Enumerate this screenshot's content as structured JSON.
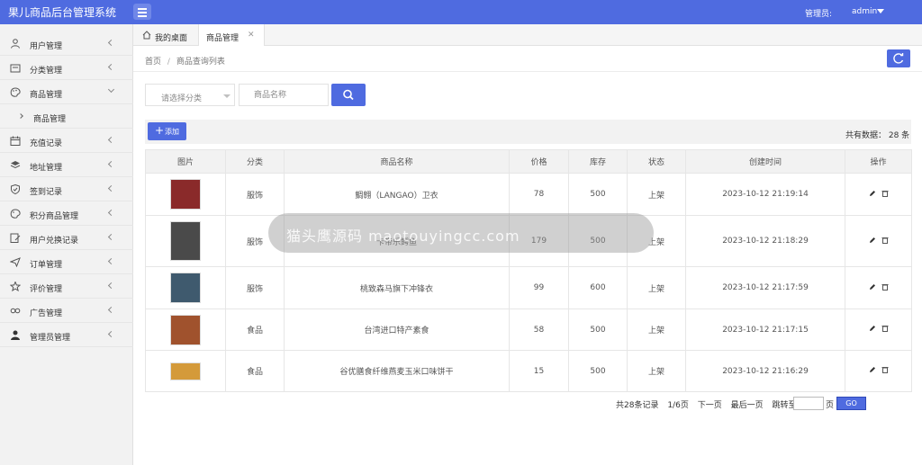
{
  "app": {
    "title": "果儿商品后台管理系统",
    "admin_label": "管理员:",
    "admin_name": "admin"
  },
  "sidebar": {
    "items": [
      {
        "label": "用户管理",
        "icon": "user-icon"
      },
      {
        "label": "分类管理",
        "icon": "category-icon"
      },
      {
        "label": "商品管理",
        "icon": "palette-icon",
        "expanded": true
      },
      {
        "label": "商品管理",
        "sub": true
      },
      {
        "label": "充值记录",
        "icon": "calendar-icon"
      },
      {
        "label": "地址管理",
        "icon": "layers-icon"
      },
      {
        "label": "签到记录",
        "icon": "shield-icon"
      },
      {
        "label": "积分商品管理",
        "icon": "palette-icon"
      },
      {
        "label": "用户兑换记录",
        "icon": "edit-doc-icon"
      },
      {
        "label": "订单管理",
        "icon": "send-icon"
      },
      {
        "label": "评价管理",
        "icon": "star-icon"
      },
      {
        "label": "广告管理",
        "icon": "link-icon"
      },
      {
        "label": "管理员管理",
        "icon": "admin-icon"
      }
    ]
  },
  "tabs": [
    {
      "label": "我的桌面"
    },
    {
      "label": "商品管理",
      "closable": true
    }
  ],
  "breadcrumb": {
    "home": "首页",
    "separator": "/",
    "current": "商品查询列表"
  },
  "search": {
    "category_placeholder": "请选择分类",
    "name_placeholder": "商品名称"
  },
  "toolbar": {
    "add_label": "添加",
    "total_text": "共有数据： 28 条"
  },
  "table": {
    "headers": [
      "图片",
      "分类",
      "商品名称",
      "价格",
      "库存",
      "状态",
      "创建时间",
      "操作"
    ],
    "rows": [
      {
        "category": "服饰",
        "name": "鲷翱（LANGAO）卫衣",
        "price": "78",
        "stock": "500",
        "status": "上架",
        "created": "2023-10-12 21:19:14",
        "thumb_color": "#8a2a2a"
      },
      {
        "category": "服饰",
        "name": "卡帝乐鳄鱼",
        "price": "179",
        "stock": "500",
        "status": "上架",
        "created": "2023-10-12 21:18:29",
        "thumb_color": "#4a4a4a"
      },
      {
        "category": "服饰",
        "name": "桃致森马旗下冲锋衣",
        "price": "99",
        "stock": "600",
        "status": "上架",
        "created": "2023-10-12 21:17:59",
        "thumb_color": "#3f5a6e"
      },
      {
        "category": "食品",
        "name": "台湾进口特产素食",
        "price": "58",
        "stock": "500",
        "status": "上架",
        "created": "2023-10-12 21:17:15",
        "thumb_color": "#a0522d"
      },
      {
        "category": "食品",
        "name": "谷优膳食纤维燕麦玉米口味饼干",
        "price": "15",
        "stock": "500",
        "status": "上架",
        "created": "2023-10-12 21:16:29",
        "thumb_color": "#d49a3a"
      }
    ]
  },
  "pager": {
    "total": "共28条记录",
    "page": "1/6页",
    "next": "下一页",
    "last": "最后一页",
    "jump": "跳转至",
    "unit": "页",
    "go": "GO"
  },
  "watermark": {
    "text": "猫头鹰源码 maotouyingcc.com"
  },
  "colors": {
    "primary": "#4f6be0",
    "sidebar_bg": "#f2f2f2",
    "header_bg": "#f2f2f2"
  }
}
